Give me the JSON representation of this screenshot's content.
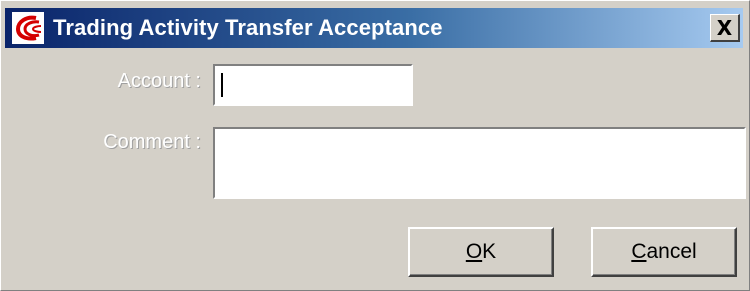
{
  "window": {
    "title": "Trading Activity Transfer Acceptance",
    "close_glyph": "X",
    "icon": "app-logo-icon",
    "titlebar_color_start": "#0a246a",
    "titlebar_color_end": "#a6caf0"
  },
  "form": {
    "account_label": "Account :",
    "account_value": "",
    "comment_label": "Comment :",
    "comment_value": ""
  },
  "buttons": {
    "ok_mnemonic": "O",
    "ok_rest": "K",
    "cancel_mnemonic": "C",
    "cancel_rest": "ancel"
  }
}
